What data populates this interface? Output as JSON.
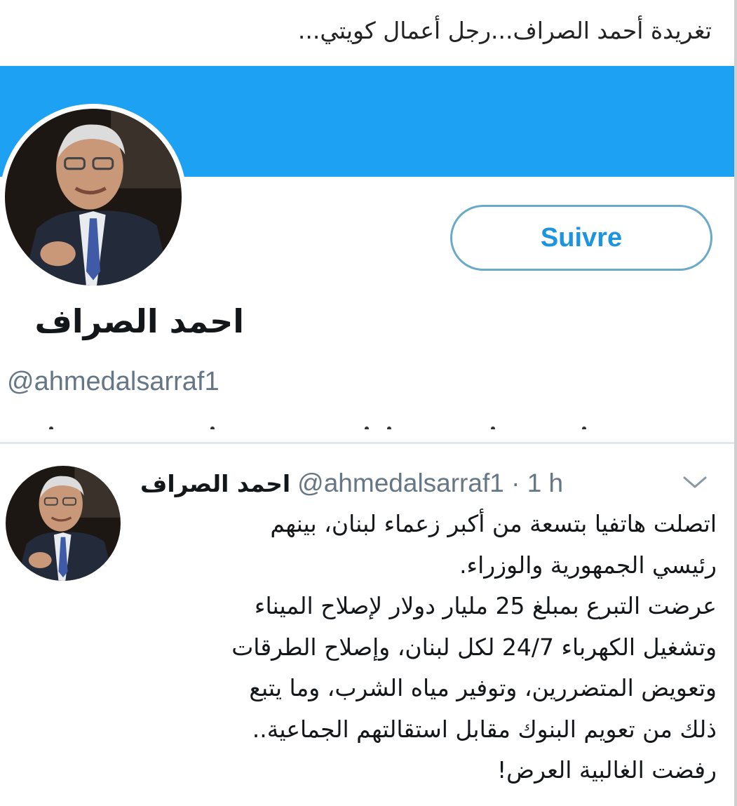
{
  "caption": "تغريدة أحمد الصراف...رجل أعمال كويتي...",
  "profile": {
    "name": "احمد الصراف",
    "handle": "@ahmedalsarraf1",
    "follow_label": "Suivre",
    "banner_color": "#1da1f2"
  },
  "tweet": {
    "author_name": "احمد الصراف",
    "author_handle": "@ahmedalsarraf1 · 1 h",
    "menu_icon": "chevron-down-icon",
    "lines": [
      "اتصلت هاتفيا بتسعة من أكبر زعماء لبنان، بينهم",
      "رئيسي الجمهورية والوزراء.",
      "عرضت التبرع بمبلغ 25 مليار دولار لإصلاح الميناء",
      "وتشغيل الكهرباء 24/7 لكل لبنان، وإصلاح الطرقات",
      "وتعويض المتضررين، وتوفير مياه الشرب، وما يتبع",
      "ذلك من تعويم البنوك مقابل استقالتهم الجماعية..",
      "رفضت الغالبية العرض!"
    ]
  },
  "colors": {
    "accent": "#1da1f2",
    "follow_text": "#1b95e0",
    "handle_gray": "#657786"
  }
}
